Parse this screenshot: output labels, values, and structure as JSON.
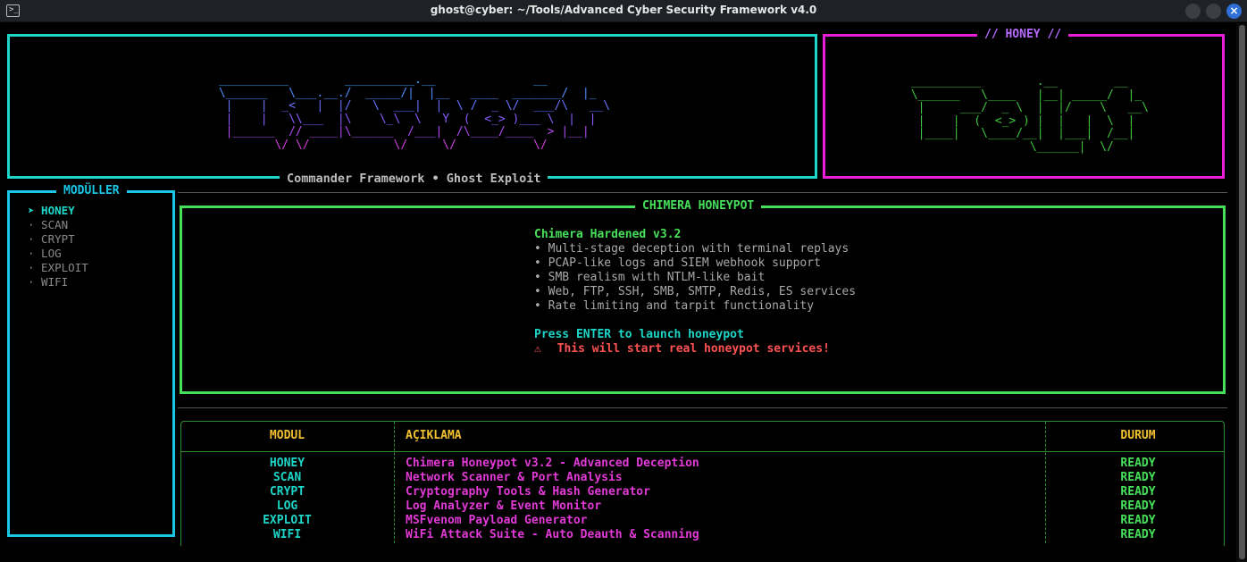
{
  "window": {
    "title": "ghost@cyber: ~/Tools/Advanced Cyber Security Framework v4.0",
    "term_icon": ">_"
  },
  "banner": {
    "subtitle": "Commander Framework • Ghost Exploit",
    "art_lines": [
      " __________        __________.__              __   ",
      " \\______   \\___.__./  _____/|  |__   ____  _______/  |_ ",
      "  |    |  _<   |  |/   \\  ___|  |  \\ /  _ \\/  ___/\\   __\\",
      "  |    |   \\\\___  |\\    \\_\\  \\   Y  (  <_> )___ \\  |  |  ",
      "  |______  // ____|\\______  /___|  /\\____/____  > |__|  ",
      "         \\/ \\/            \\/     \\/           \\/        "
    ],
    "art_colors": [
      "#3ba8ff",
      "#4d8dff",
      "#6a74ff",
      "#8a5cff",
      "#b04bef",
      "#d13fe0"
    ]
  },
  "honey_panel": {
    "title": "// HONEY //",
    "art_lines": [
      " __________        .__        __   ",
      " \\______   \\____   |__| _____/  |_ ",
      "  |     ___/  _ \\  |  |/    \\   __\\",
      "  |    |  (  <_> ) |  |   |  \\  |  ",
      "  |____|   \\____/__|  |___|  /__|  ",
      "                  \\______|  \\/     "
    ],
    "art_color": "#3ec43e"
  },
  "sidebar": {
    "title": "MODÜLLER",
    "items": [
      {
        "label": "➤ HONEY",
        "active": true
      },
      {
        "label": "· SCAN",
        "active": false
      },
      {
        "label": "· CRYPT",
        "active": false
      },
      {
        "label": "· LOG",
        "active": false
      },
      {
        "label": "· EXPLOIT",
        "active": false
      },
      {
        "label": "· WIFI",
        "active": false
      }
    ]
  },
  "detail": {
    "title": "CHIMERA HONEYPOT",
    "heading": "Chimera Hardened v3.2",
    "features": [
      "• Multi-stage deception with terminal replays",
      "• PCAP-like logs and SIEM webhook support",
      "• SMB realism with NTLM-like bait",
      "• Web, FTP, SSH, SMB, SMTP, Redis, ES services",
      "• Rate limiting and tarpit functionality"
    ],
    "prompt": "Press ENTER to launch honeypot",
    "warning_icon": "⚠",
    "warning": "This will start real honeypot services!"
  },
  "table": {
    "headers": {
      "module": "MODUL",
      "description": "AÇIKLAMA",
      "status": "DURUM"
    },
    "rows": [
      {
        "module": "HONEY",
        "description": "Chimera Honeypot v3.2 - Advanced Deception",
        "status": "READY"
      },
      {
        "module": "SCAN",
        "description": "Network Scanner & Port Analysis",
        "status": "READY"
      },
      {
        "module": "CRYPT",
        "description": "Cryptography Tools & Hash Generator",
        "status": "READY"
      },
      {
        "module": "LOG",
        "description": "Log Analyzer & Event Monitor",
        "status": "READY"
      },
      {
        "module": "EXPLOIT",
        "description": "MSFvenom Payload Generator",
        "status": "READY"
      },
      {
        "module": "WIFI",
        "description": "WiFi Attack Suite - Auto Deauth & Scanning",
        "status": "READY"
      }
    ]
  },
  "colors": {
    "cyan": "#1ed6c8",
    "magenta": "#e81ed8",
    "green": "#46e05a",
    "sidebar_border": "#19c6e6",
    "yellow": "#f2c12e",
    "red": "#ff5252",
    "pink_text": "#e23ad6"
  }
}
